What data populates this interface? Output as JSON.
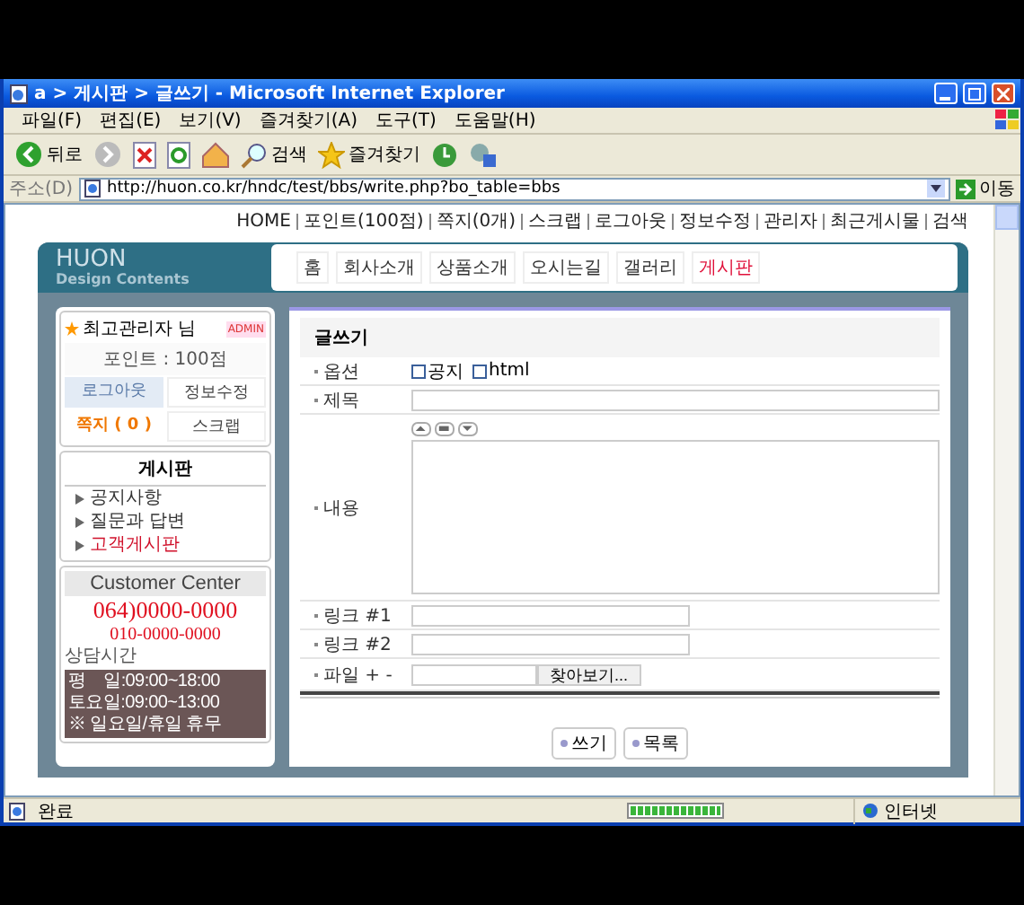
{
  "window": {
    "title": "a > 게시판 > 글쓰기 - Microsoft Internet Explorer"
  },
  "menu": [
    "파일(F)",
    "편집(E)",
    "보기(V)",
    "즐겨찾기(A)",
    "도구(T)",
    "도움말(H)"
  ],
  "toolbar": [
    {
      "kind": "back",
      "label": "뒤로"
    },
    {
      "kind": "forward"
    },
    {
      "kind": "stop"
    },
    {
      "kind": "refresh"
    },
    {
      "kind": "home"
    },
    {
      "kind": "search",
      "label": "검색"
    },
    {
      "kind": "favorites",
      "label": "즐겨찾기"
    },
    {
      "kind": "history"
    },
    {
      "kind": "media"
    }
  ],
  "address": {
    "label": "주소(D)",
    "value": "http://huon.co.kr/hndc/test/bbs/write.php?bo_table=bbs",
    "go": "이동"
  },
  "top_links": [
    "HOME",
    "포인트(100점)",
    "쪽지(0개)",
    "스크랩",
    "로그아웃",
    "정보수정",
    "관리자",
    "최근게시물",
    "검색"
  ],
  "logo": {
    "title": "HUON",
    "subtitle": "Design Contents"
  },
  "nav": [
    {
      "label": "홈",
      "selected": false
    },
    {
      "label": "회사소개",
      "selected": false
    },
    {
      "label": "상품소개",
      "selected": false
    },
    {
      "label": "오시는길",
      "selected": false
    },
    {
      "label": "갤러리",
      "selected": false
    },
    {
      "label": "게시판",
      "selected": true
    }
  ],
  "member": {
    "name": "최고관리자 님",
    "badge": "ADMIN",
    "points": "포인트 : 100점",
    "buttons": [
      {
        "label": "로그아웃",
        "kind": "shaded"
      },
      {
        "label": "정보수정",
        "kind": "bullet"
      },
      {
        "label": "쪽지 ( 0 )",
        "kind": "count"
      },
      {
        "label": "스크랩",
        "kind": "bullet"
      }
    ]
  },
  "board_menu": {
    "title": "게시판",
    "items": [
      {
        "label": "공지사항",
        "selected": false
      },
      {
        "label": "질문과 답변",
        "selected": false
      },
      {
        "label": "고객게시판",
        "selected": true
      }
    ]
  },
  "customer_center": {
    "title": "Customer Center",
    "phone": "064)0000-0000",
    "phone2": "010-0000-0000",
    "hours_title": "상담시간",
    "hours": [
      "평    일:09:00~18:00",
      "토요일:09:00~13:00",
      "※ 일요일/휴일 휴무"
    ]
  },
  "form": {
    "title": "글쓰기",
    "rows": [
      {
        "kind": "options",
        "label": "옵션",
        "options": [
          {
            "label": "공지",
            "checked": false
          },
          {
            "label": "html",
            "checked": false
          }
        ]
      },
      {
        "kind": "text",
        "label": "제목"
      },
      {
        "kind": "textarea",
        "label": "내용"
      },
      {
        "kind": "link",
        "label": "링크 #1"
      },
      {
        "kind": "link",
        "label": "링크 #2"
      },
      {
        "kind": "file",
        "label": "파일 + -",
        "button": "찾아보기..."
      }
    ],
    "buttons": [
      "쓰기",
      "목록"
    ]
  },
  "status_bar": {
    "text": "완료",
    "progress": {
      "level": 1
    },
    "zone": "인터넷"
  }
}
